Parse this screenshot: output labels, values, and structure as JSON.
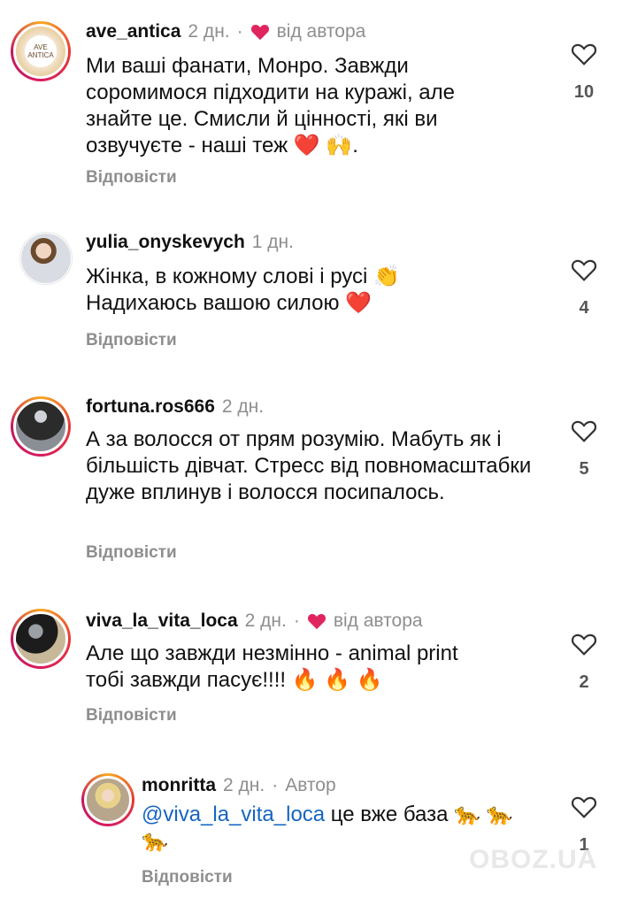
{
  "reply_label": "Відповісти",
  "colors": {
    "accent_red": "#e0245e",
    "mention": "#1565c0",
    "muted": "#8e8e8e"
  },
  "comments": [
    {
      "user": "ave_antica",
      "time": "2 дн.",
      "dot": "·",
      "liked_by_author": "від автора",
      "text": "Ми ваші фанати, Монро. Завжди соромимося підходити на куражі, але знайте це. Смисли й цінності, які ви озвучуєте - наші теж ❤️ 🙌.",
      "likes": "10",
      "avatar_text": "AVE ANTICA"
    },
    {
      "user": "yulia_onyskevych",
      "time": "1 дн.",
      "text": "Жінка, в кожному слові і русі 👏 Надихаюсь вашою силою ❤️",
      "likes": "4"
    },
    {
      "user": "fortuna.ros666",
      "time": "2 дн.",
      "text": "А за волосся от прям розумію. Мабуть як і більшість дівчат. Стресс від повномасштабки дуже вплинув і волосся посипалось.",
      "likes": "5"
    },
    {
      "user": "viva_la_vita_loca",
      "time": "2 дн.",
      "dot": "·",
      "liked_by_author": "від автора",
      "text": "Але що завжди незмінно - animal print тобі завжди пасує!!!! 🔥 🔥 🔥",
      "likes": "2"
    },
    {
      "user": "monritta",
      "time": "2 дн.",
      "dot": "·",
      "author_label": "Автор",
      "mention": "@viva_la_vita_loca",
      "text": " це вже база 🐆 🐆 🐆",
      "likes": "1"
    }
  ],
  "watermark": "OBOZ.UA"
}
